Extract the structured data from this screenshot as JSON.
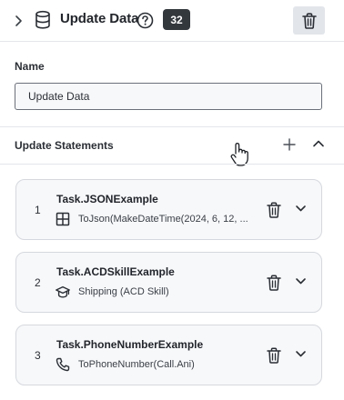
{
  "header": {
    "title": "Update Data",
    "badge": "32"
  },
  "name_field": {
    "label": "Name",
    "value": "Update Data"
  },
  "statements": {
    "title": "Update Statements",
    "items": [
      {
        "index": "1",
        "variable": "Task.JSONExample",
        "value": "ToJson(MakeDateTime(2024, 6, 12, ...",
        "icon": "grid-icon"
      },
      {
        "index": "2",
        "variable": "Task.ACDSkillExample",
        "value": "Shipping (ACD Skill)",
        "icon": "graduation-cap-icon"
      },
      {
        "index": "3",
        "variable": "Task.PhoneNumberExample",
        "value": "ToPhoneNumber(Call.Ani)",
        "icon": "phone-icon"
      }
    ]
  },
  "colors": {
    "badge_bg": "#33383d",
    "card_bg": "#f7f8fa",
    "header_button_bg": "#e2e5ea"
  }
}
